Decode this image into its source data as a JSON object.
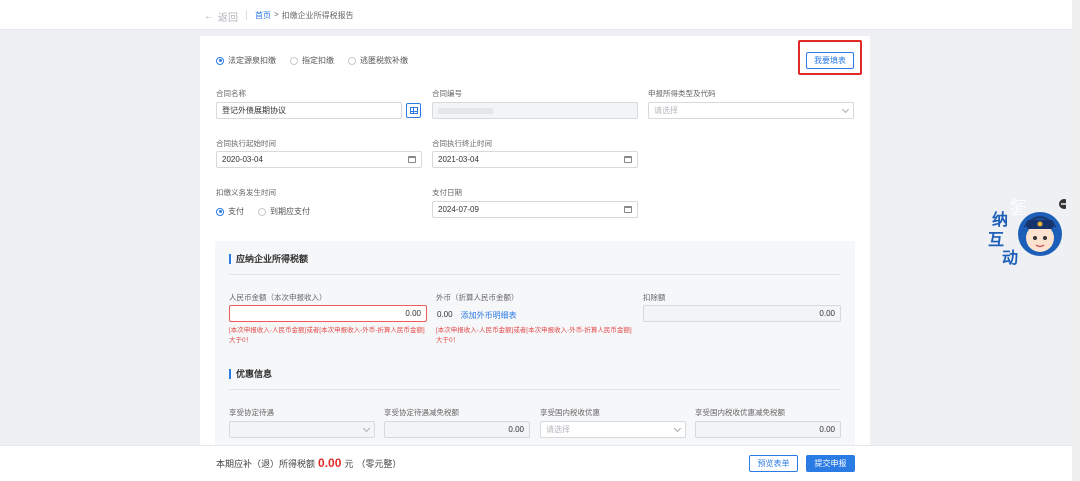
{
  "nav": {
    "back": "返回",
    "home": "首页",
    "arrow": ">",
    "current": "扣缴企业所得税报告"
  },
  "modes": [
    {
      "label": "法定源泉扣缴",
      "checked": true
    },
    {
      "label": "指定扣缴",
      "checked": false
    },
    {
      "label": "逃匿税款补缴",
      "checked": false
    }
  ],
  "fill_button": "我要填表",
  "fields": {
    "contract_name": {
      "label": "合同名称",
      "value": "登记外债展期协议"
    },
    "contract_no": {
      "label": "合同编号",
      "value": ""
    },
    "income_type": {
      "label": "申报所得类型及代码",
      "placeholder": "请选择"
    },
    "start_date": {
      "label": "合同执行起始时间",
      "value": "2020-03-04"
    },
    "end_date": {
      "label": "合同执行终止时间",
      "value": "2021-03-04"
    },
    "obligation": {
      "label": "扣缴义务发生时间",
      "options": [
        {
          "label": "支付",
          "checked": true
        },
        {
          "label": "到期应支付",
          "checked": false
        }
      ]
    },
    "pay_date": {
      "label": "支付日期",
      "value": "2024-07-09"
    }
  },
  "tax_section": {
    "title": "应纳企业所得税额",
    "rmb": {
      "label": "人民币金额（本次申报收入）",
      "value": "0.00",
      "error": "[本次申报收入-人民币金额]或者[本次申报收入-外币-折算人民币金额]大于0！"
    },
    "foreign": {
      "label": "外币（折算人民币金额）",
      "value": "0.00",
      "link": "添加外币明细表",
      "error": "[本次申报收入-人民币金额]或者[本次申报收入-外币-折算人民币金额]大于0！"
    },
    "deduction": {
      "label": "扣除额",
      "value": "0.00"
    }
  },
  "discount_section": {
    "title": "优惠信息",
    "treaty": {
      "label": "享受协定待遇"
    },
    "treaty_amount": {
      "label": "享受协定待遇减免税额",
      "value": "0.00"
    },
    "domestic": {
      "label": "享受国内税收优惠",
      "placeholder": "请选择"
    },
    "domestic_amount": {
      "label": "享受国内税收优惠减免税额",
      "value": "0.00"
    }
  },
  "footer": {
    "prefix": "本期应补（退）所得税额",
    "amount": "0.00",
    "unit": "元",
    "words": "（零元整）",
    "preview": "预览表单",
    "submit": "提交申报"
  },
  "assistant": {
    "chars": [
      "征",
      "纳",
      "互",
      "动"
    ]
  },
  "colors": {
    "primary": "#2b7be5",
    "error": "#e02a2a",
    "highlight": "#e02a2a"
  }
}
